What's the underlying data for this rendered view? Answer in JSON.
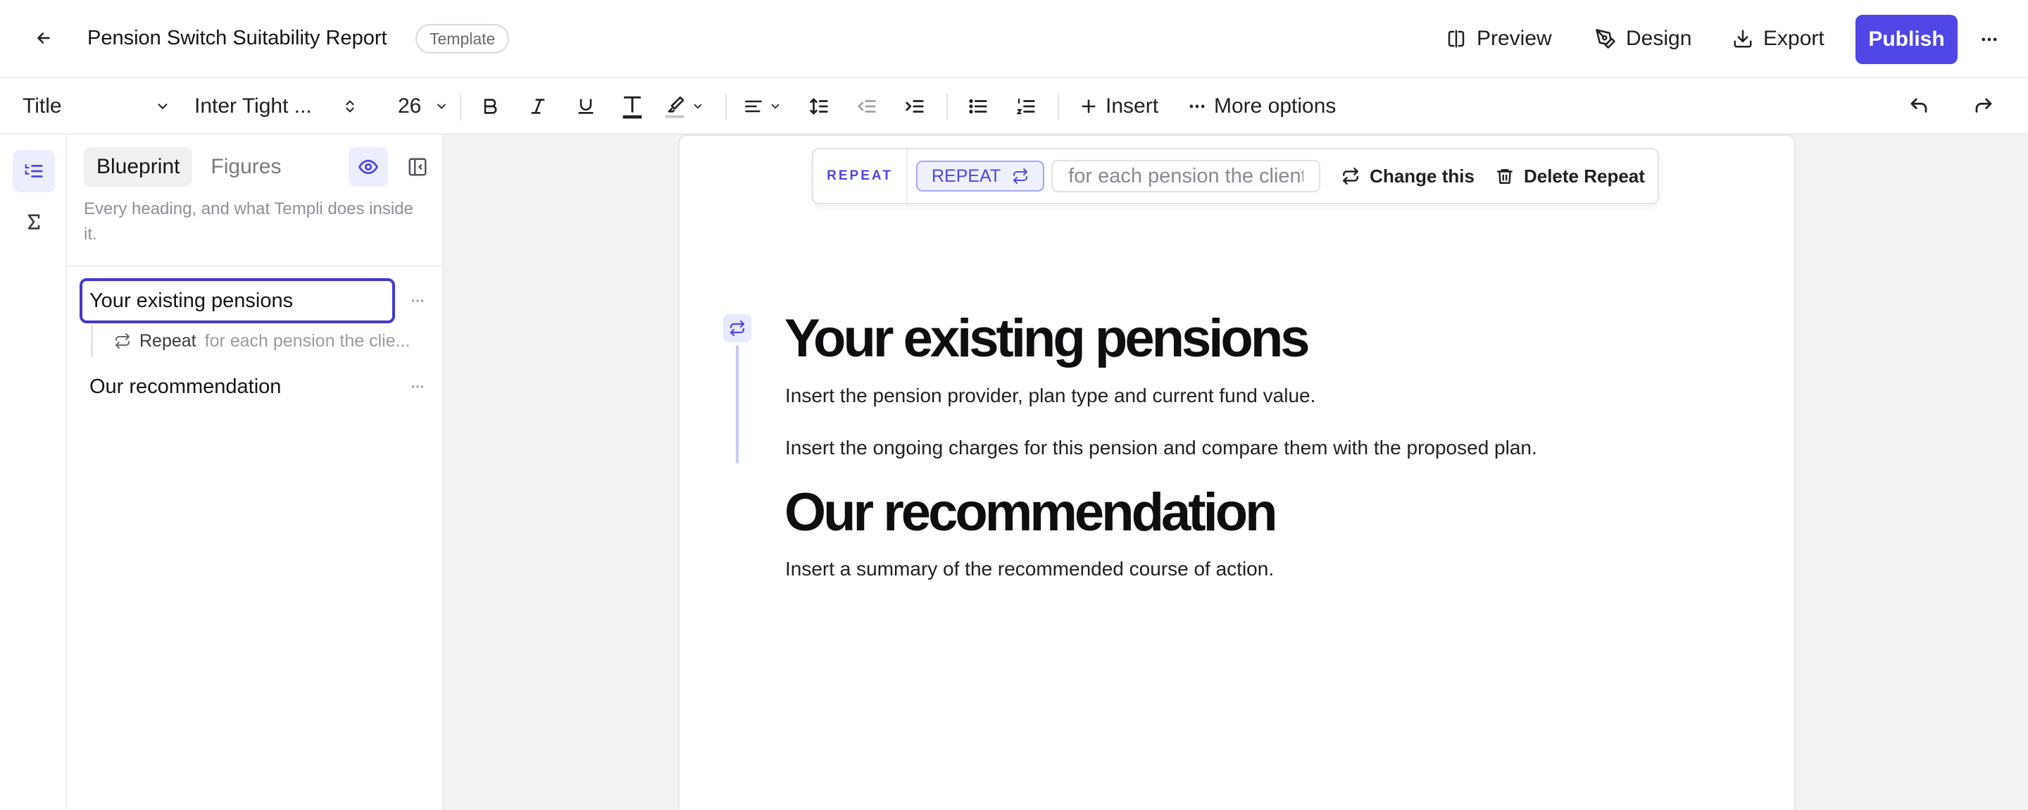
{
  "header": {
    "title": "Pension Switch Suitability Report",
    "badge": "Template",
    "preview_label": "Preview",
    "design_label": "Design",
    "export_label": "Export",
    "publish_label": "Publish"
  },
  "toolbar": {
    "style_value": "Title",
    "font_value": "Inter Tight ...",
    "size_value": "26",
    "insert_label": "Insert",
    "more_options_label": "More options"
  },
  "panel": {
    "tabs": [
      "Blueprint",
      "Figures"
    ],
    "description": "Every heading, and what Templi does inside it.",
    "outline": [
      {
        "label": "Your existing pensions"
      },
      {
        "label": "Our recommendation"
      }
    ],
    "sub_item": {
      "label": "Repeat",
      "text": "for each pension the clie..."
    }
  },
  "repeat_bar": {
    "label": "REPEAT",
    "pill": "REPEAT",
    "input_value": "for each pension the client",
    "change_label": "Change this",
    "delete_label": "Delete Repeat"
  },
  "document": {
    "sections": [
      {
        "heading": "Your existing pensions",
        "paragraphs": [
          "Insert the pension provider, plan type and current fund value.",
          "Insert the ongoing charges for this pension and compare them with the proposed plan."
        ]
      },
      {
        "heading": "Our recommendation",
        "paragraphs": [
          "Insert a summary of the recommended course of action."
        ]
      }
    ]
  },
  "colors": {
    "accent": "#4f46e5",
    "accent_light": "#eceefe",
    "selected_border": "#4338ca"
  }
}
